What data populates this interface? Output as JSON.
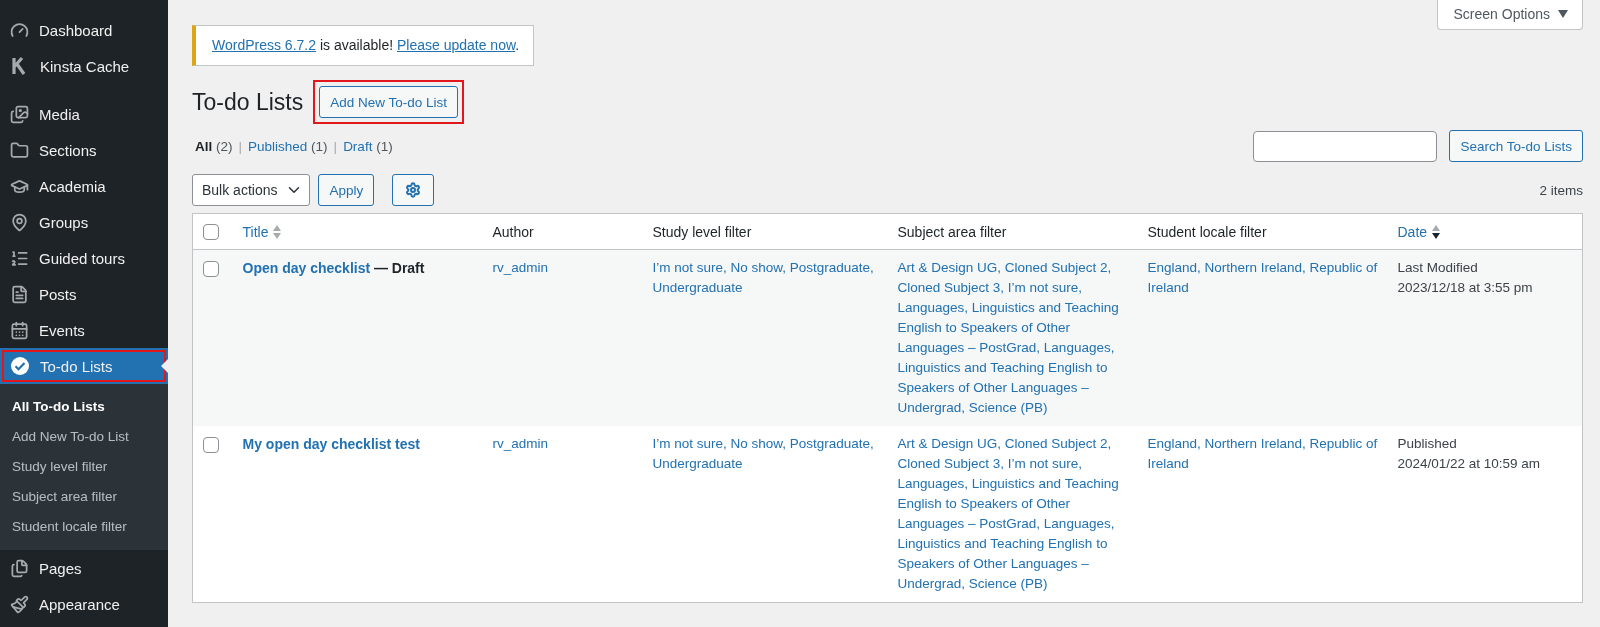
{
  "sidebar": {
    "groups": [
      {
        "items": [
          {
            "label": "Dashboard",
            "selected": false,
            "highlighted": false
          },
          {
            "label": "Kinsta Cache",
            "selected": false,
            "highlighted": false
          }
        ]
      },
      {
        "items": [
          {
            "label": "Media",
            "selected": false,
            "highlighted": false
          },
          {
            "label": "Sections",
            "selected": false,
            "highlighted": false
          },
          {
            "label": "Academia",
            "selected": false,
            "highlighted": false
          },
          {
            "label": "Groups",
            "selected": false,
            "highlighted": false
          },
          {
            "label": "Guided tours",
            "selected": false,
            "highlighted": false
          },
          {
            "label": "Posts",
            "selected": false,
            "highlighted": false
          },
          {
            "label": "Events",
            "selected": false,
            "highlighted": false
          },
          {
            "label": "To-do Lists",
            "selected": true,
            "highlighted": true,
            "children": [
              {
                "label": "All To-do Lists",
                "selected": true
              },
              {
                "label": "Add New To-do List",
                "selected": false
              },
              {
                "label": "Study level filter",
                "selected": false
              },
              {
                "label": "Subject area filter",
                "selected": false
              },
              {
                "label": "Student locale filter",
                "selected": false
              }
            ]
          },
          {
            "label": "Pages",
            "selected": false,
            "highlighted": false
          },
          {
            "label": "Appearance",
            "selected": false,
            "highlighted": false
          }
        ]
      }
    ]
  },
  "screen_options": "Screen Options",
  "notice": {
    "parts": [
      {
        "kind": "link",
        "text": "WordPress 6.7.2"
      },
      {
        "kind": "text",
        "text": " is available! "
      },
      {
        "kind": "link",
        "text": "Please update now"
      },
      {
        "kind": "text",
        "text": "."
      }
    ]
  },
  "page_title": "To-do Lists",
  "add_new": {
    "label": "Add New To-do List",
    "highlighted": true
  },
  "views": {
    "separator": "|",
    "items": [
      {
        "label": "All",
        "count": "(2)",
        "selected": true
      },
      {
        "label": "Published",
        "count": "(1)",
        "selected": false
      },
      {
        "label": "Draft",
        "count": "(1)",
        "selected": false
      }
    ]
  },
  "search": {
    "button": "Search To-do Lists"
  },
  "bulk_actions": "Bulk actions",
  "apply": "Apply",
  "items_count": "2 items",
  "table": {
    "select_all_checked": false,
    "columns": [
      {
        "label": "Title",
        "sortable": true,
        "sorted": false
      },
      {
        "label": "Author",
        "sortable": false
      },
      {
        "label": "Study level filter",
        "sortable": false
      },
      {
        "label": "Subject area filter",
        "sortable": false
      },
      {
        "label": "Student locale filter",
        "sortable": false
      },
      {
        "label": "Date",
        "sortable": true,
        "sorted": true
      }
    ],
    "rows": [
      {
        "checked": false,
        "title": "Open day checklist",
        "post_state": "— Draft",
        "author": "rv_admin",
        "study_level": "I’m not sure, No show, Postgraduate, Undergraduate",
        "subject_area": "Art & Design UG, Cloned Subject 2, Cloned Subject 3, I’m not sure, Languages, Linguistics and Teaching English to Speakers of Other Languages – PostGrad, Languages, Linguistics and Teaching English to Speakers of Other Languages – Undergrad, Science (PB)",
        "student_locale": "England, Northern Ireland, Republic of Ireland",
        "date_status": "Last Modified",
        "date": "2023/12/18 at 3:55 pm"
      },
      {
        "checked": false,
        "title": "My open day checklist test",
        "author": "rv_admin",
        "study_level": "I’m not sure, No show, Postgraduate, Undergraduate",
        "subject_area": "Art & Design UG, Cloned Subject 2, Cloned Subject 3, I’m not sure, Languages, Linguistics and Teaching English to Speakers of Other Languages – PostGrad, Languages, Linguistics and Teaching English to Speakers of Other Languages – Undergrad, Science (PB)",
        "student_locale": "England, Northern Ireland, Republic of Ireland",
        "date_status": "Published",
        "date": "2024/01/22 at 10:59 am"
      }
    ]
  }
}
